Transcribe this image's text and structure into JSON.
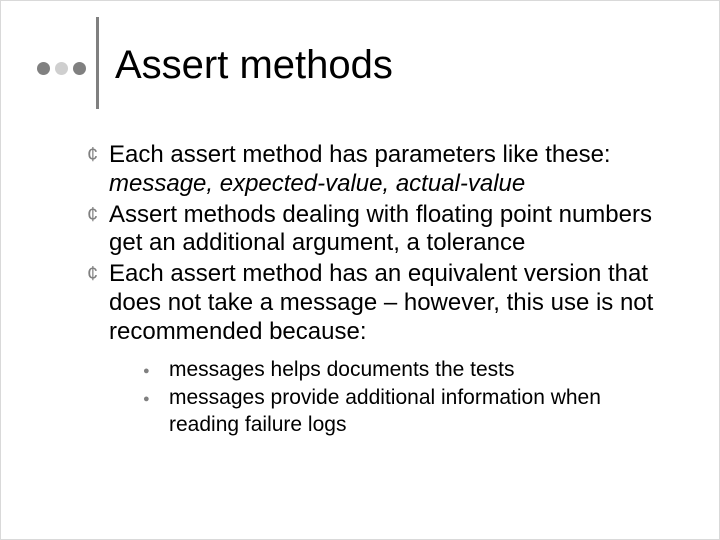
{
  "title": "Assert methods",
  "bullets": [
    {
      "text": "Each assert method has parameters like these:",
      "line2_italic": "message, expected-value, actual-value"
    },
    {
      "text": "Assert methods dealing with floating point numbers get an additional argument, a tolerance"
    },
    {
      "text": "Each assert method has an equivalent version that does not take a message – however, this use is not recommended because:"
    }
  ],
  "subbullets": [
    "messages helps documents the tests",
    "messages provide additional information when reading failure logs"
  ],
  "markers": {
    "main": "¢",
    "sub": "●"
  }
}
